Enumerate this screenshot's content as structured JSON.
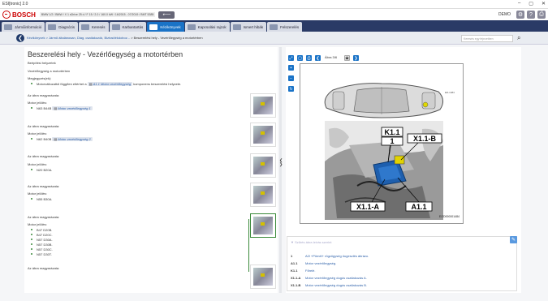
{
  "window": {
    "title": "ESI[tronic] 2.0",
    "controls": [
      "–",
      "▢",
      "✕"
    ]
  },
  "brand": {
    "name": "BOSCH",
    "vehicle": "BMW 1/2 / BMW / X 1 sDrive 25 d / F 15 / 2.0 / 160.0 kW / 16/2015 - 07/2019 / BMT 5385",
    "demo": "DEMO"
  },
  "tabs": [
    {
      "label": "Járműinformáció"
    },
    {
      "label": "Diagnózis"
    },
    {
      "label": "Keresés"
    },
    {
      "label": "Karbantartás"
    },
    {
      "label": "Kézikönyvek"
    },
    {
      "label": "Kapcsolási rajzok"
    },
    {
      "label": "Ismert hibák"
    },
    {
      "label": "Felszerelés"
    }
  ],
  "breadcrumb": {
    "items": [
      "Kézikönyvek",
      "> Jármű általánosan, Diag. csatlakozók, Biztosítékdoboz...",
      "> Beszerelési hely - Vezérlőegység a motortérben"
    ],
    "search_placeholder": "Keresés egy fejezetben"
  },
  "left": {
    "title": "Beszerelési hely - Vezérlőegység a motortérben",
    "intro": [
      "Beépítési helyzetek",
      "Vezérlőegység a motortérben",
      "Megjegyzés(ek):"
    ],
    "note_pre": "Motorváltozattól függően eltérhet a",
    "note_link": "A1.1 Motor vezérlőegység",
    "note_post": "komponens beszerelési helyzete.",
    "groups": [
      {
        "head": "Az ábra magyarázata:",
        "sub": "Motor jelölés:",
        "items": [
          "N63 B44B"
        ],
        "link": "Motor vezérlőegység 1"
      },
      {
        "head": "Az ábra magyarázata:",
        "sub": "Motor jelölés:",
        "items": [
          "N62 B40B"
        ],
        "link": "Motor vezérlőegység 2"
      },
      {
        "head": "Az ábra magyarázata:",
        "sub": "Motor jelölés:",
        "items": [
          "N20 B20A."
        ]
      },
      {
        "head": "Az ábra magyarázata:",
        "sub": "Motor jelölés:",
        "items": [
          "N55 B30A."
        ]
      },
      {
        "head": "Az ábra magyarázata:",
        "sub": "Motor jelölés:",
        "items": [
          "B47 D20B.",
          "B47 D20C.",
          "N57 D30A.",
          "N57 D30B.",
          "N57 D30C.",
          "N57 D30T."
        ]
      },
      {
        "head": "Az ábra magyarázata:"
      }
    ]
  },
  "viewer": {
    "nav": "Ábra 3/6",
    "image_id": "EOD000001484",
    "callouts": [
      "K1.1",
      "1",
      "X1.1-B",
      "X1.1-A",
      "A1.1"
    ]
  },
  "legend": {
    "filter_placeholder": "Szűrés ábra leírás szerint",
    "rows": [
      {
        "key": "1",
        "desc": "A2l +Pömél+ rögzögység öugeszlés ábrázo."
      },
      {
        "key": "A1.1",
        "desc": "Motor vezérlőegység."
      },
      {
        "key": "K1.1",
        "desc": "Főrelé."
      },
      {
        "key": "X1.1-A",
        "desc": "Motor vezérlőegység dugós csatlakozás A."
      },
      {
        "key": "X1.1-B",
        "desc": "Motor vezérlőegység dugós csatlakozás B."
      }
    ]
  },
  "colors": {
    "accent": "#1a73c7",
    "tabbar": "#2a3a66",
    "brand": "#cc0000"
  }
}
